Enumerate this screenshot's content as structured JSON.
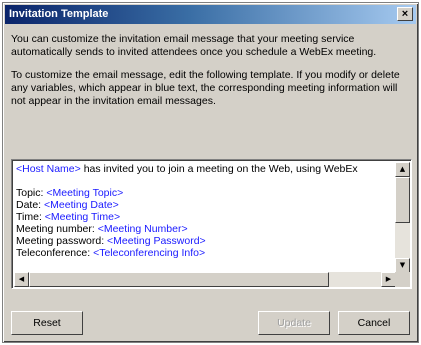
{
  "window": {
    "title": "Invitation Template",
    "close_glyph": "×"
  },
  "description": {
    "para1": "You can customize the invitation email message that your meeting service automatically sends to invited attendees once you schedule a WebEx meeting.",
    "para2": "To customize the email message, edit the following template. If you modify or delete any variables, which appear in blue text, the corresponding meeting information will not appear in the invitation email messages."
  },
  "template": {
    "line1": {
      "var": "<Host Name>",
      "text": " has invited you to join a meeting on the Web, using WebEx"
    },
    "topic": {
      "label": "Topic: ",
      "var": "<Meeting Topic>"
    },
    "date": {
      "label": "Date: ",
      "var": "<Meeting Date>"
    },
    "time": {
      "label": "Time: ",
      "var": "<Meeting Time>"
    },
    "number": {
      "label": "Meeting number: ",
      "var": "<Meeting Number>"
    },
    "password": {
      "label": "Meeting password: ",
      "var": "<Meeting Password>"
    },
    "teleconf": {
      "label": "Teleconference: ",
      "var": "<Teleconferencing Info>"
    }
  },
  "buttons": {
    "reset": "Reset",
    "update": "Update",
    "cancel": "Cancel"
  },
  "colors": {
    "variable_text": "#1a1aff",
    "title_bar": "#0a246a",
    "dialog_bg": "#d4d0c8"
  },
  "icons": {
    "close": "close-icon",
    "scroll_up": "arrow-up-icon",
    "scroll_down": "arrow-down-icon",
    "scroll_left": "arrow-left-icon",
    "scroll_right": "arrow-right-icon"
  }
}
